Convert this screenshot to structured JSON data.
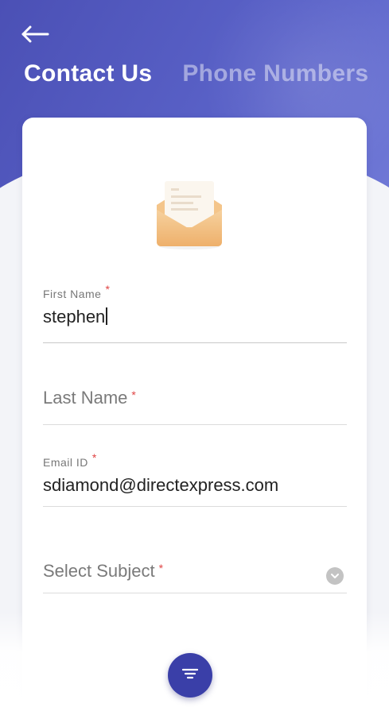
{
  "header": {
    "tabs": [
      {
        "label": "Contact Us",
        "active": true
      },
      {
        "label": "Phone Numbers",
        "active": false
      }
    ]
  },
  "form": {
    "first_name": {
      "label": "First Name",
      "required_mark": "*",
      "value": "stephen"
    },
    "last_name": {
      "label": "Last Name",
      "required_mark": "*",
      "value": ""
    },
    "email": {
      "label": "Email ID",
      "required_mark": "*",
      "value": "sdiamond@directexpress.com"
    },
    "subject": {
      "label": "Select Subject",
      "required_mark": "*",
      "value": ""
    }
  },
  "icons": {
    "back": "arrow-left-icon",
    "envelope": "envelope-open-icon",
    "dropdown": "chevron-down-icon",
    "menu": "menu-lines-icon"
  },
  "colors": {
    "header_primary": "#4b50b5",
    "fab": "#3a3fa8",
    "required": "#e04444",
    "envelope": "#f2c083"
  }
}
